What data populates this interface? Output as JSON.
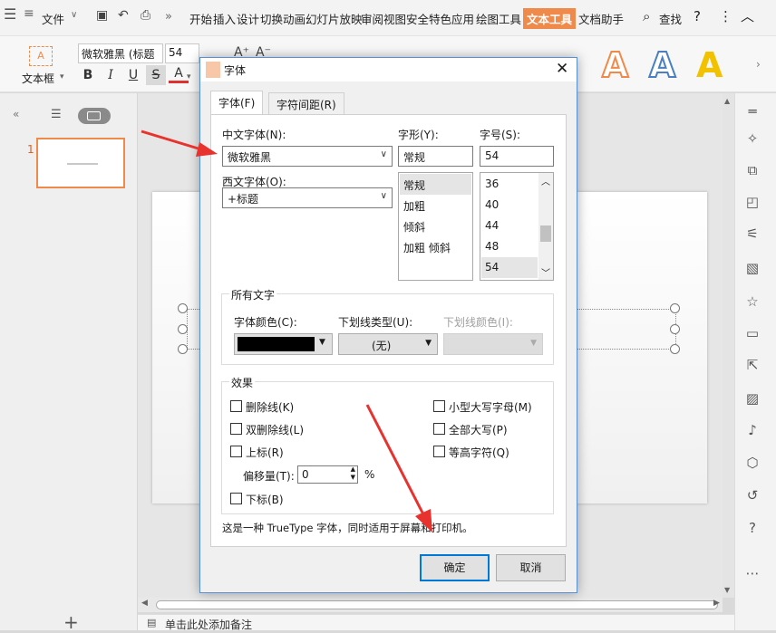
{
  "titlebar": {
    "file_menu": "文件",
    "tabs": [
      "开始",
      "插入",
      "设计",
      "切换",
      "动画",
      "幻灯片放映",
      "审阅",
      "视图",
      "安全",
      "特色应用",
      "绘图工具",
      "文本工具",
      "文档助手"
    ],
    "search": "查找"
  },
  "ribbon": {
    "textbox_label": "文本框",
    "font_name": "微软雅黑 (标题",
    "font_size": "54",
    "art_letters": [
      "A",
      "A",
      "A"
    ],
    "art_colors": [
      "#f08a4b",
      "#4a7fc1",
      "#f2c200"
    ]
  },
  "left_panel": {
    "slide_number": "1"
  },
  "notes": {
    "placeholder": "单击此处添加备注"
  },
  "dialog": {
    "title": "字体",
    "tabs": [
      "字体(F)",
      "字符间距(R)"
    ],
    "cn_font_label": "中文字体(N):",
    "cn_font_value": "微软雅黑",
    "west_font_label": "西文字体(O):",
    "west_font_value": "+标题",
    "style_label": "字形(Y):",
    "style_value": "常规",
    "style_options": [
      "常规",
      "加粗",
      "倾斜",
      "加粗 倾斜"
    ],
    "size_label": "字号(S):",
    "size_value": "54",
    "size_options": [
      "36",
      "40",
      "44",
      "48",
      "54"
    ],
    "all_text_group": "所有文字",
    "color_label": "字体颜色(C):",
    "color_value": "#000000",
    "underline_type_label": "下划线类型(U):",
    "underline_type_value": "(无)",
    "underline_color_label": "下划线颜色(I):",
    "effects_group": "效果",
    "effects_left": [
      "删除线(K)",
      "双删除线(L)",
      "上标(R)",
      "下标(B)"
    ],
    "effects_right": [
      "小型大写字母(M)",
      "全部大写(P)",
      "等高字符(Q)"
    ],
    "offset_label": "偏移量(T):",
    "offset_value": "0",
    "offset_unit": "%",
    "hint": "这是一种 TrueType 字体，同时适用于屏幕和打印机。",
    "ok": "确定",
    "cancel": "取消"
  }
}
